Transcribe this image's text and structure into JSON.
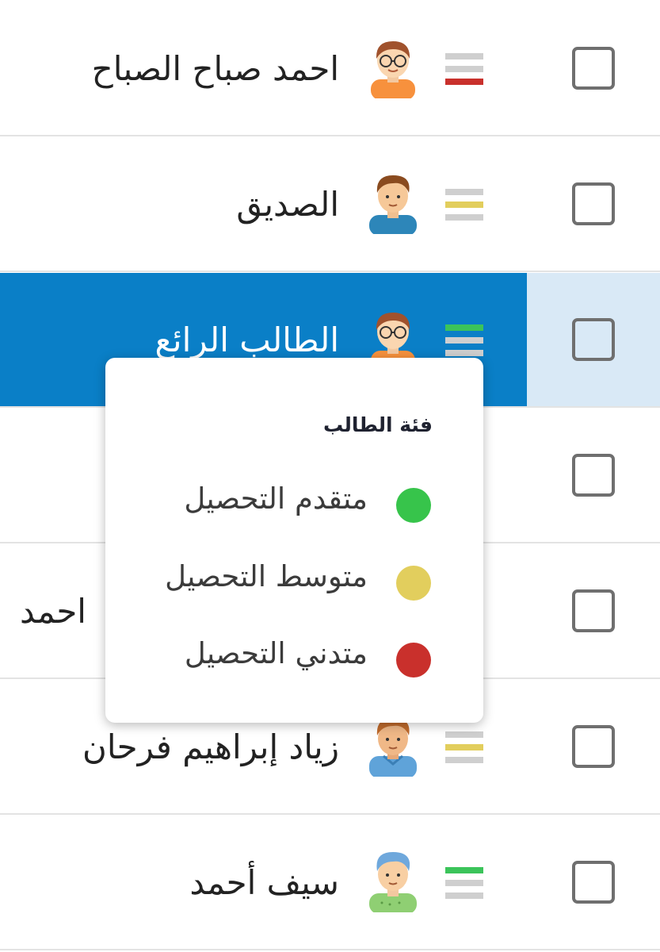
{
  "students": [
    {
      "name": "احمد صباح الصباح",
      "category": "low",
      "bars": [
        "#cfcfcf",
        "#cfcfcf",
        "#c9302c"
      ],
      "avatar": "boy-glasses-orange-avatar",
      "checked": false,
      "selected": false
    },
    {
      "name": "الصديق",
      "category": "mid",
      "bars": [
        "#cfcfcf",
        "#e2ce5d",
        "#cfcfcf"
      ],
      "avatar": "boy-blue-shirt-avatar",
      "checked": false,
      "selected": false
    },
    {
      "name": "الطالب الرائع",
      "category": "high",
      "bars": [
        "#3bc45a",
        "#cfcfcf",
        "#cfcfcf"
      ],
      "avatar": "boy-glasses-orange-avatar",
      "checked": false,
      "selected": true
    },
    {
      "name": "",
      "category": "",
      "bars": [],
      "avatar": "",
      "checked": false,
      "selected": false
    },
    {
      "name": "احمد",
      "category": "",
      "bars": [],
      "avatar": "",
      "checked": false,
      "selected": false
    },
    {
      "name": "زياد إبراهيم فرحان",
      "category": "mid",
      "bars": [
        "#cfcfcf",
        "#e2ce5d",
        "#cfcfcf"
      ],
      "avatar": "boy-hoodie-avatar",
      "checked": false,
      "selected": false
    },
    {
      "name": "سيف أحمد",
      "category": "high",
      "bars": [
        "#3bc45a",
        "#cfcfcf",
        "#cfcfcf"
      ],
      "avatar": "boy-blue-hair-avatar",
      "checked": false,
      "selected": false
    }
  ],
  "category_popup": {
    "title": "فئة الطالب",
    "items": [
      {
        "label": "متقدم التحصيل",
        "color": "#37c44b"
      },
      {
        "label": "متوسط التحصيل",
        "color": "#e2ce5d"
      },
      {
        "label": "متدني التحصيل",
        "color": "#c9302c"
      }
    ]
  },
  "colors": {
    "selected_row": "#0a7fc7",
    "selected_check_cell": "#d9e9f6"
  }
}
